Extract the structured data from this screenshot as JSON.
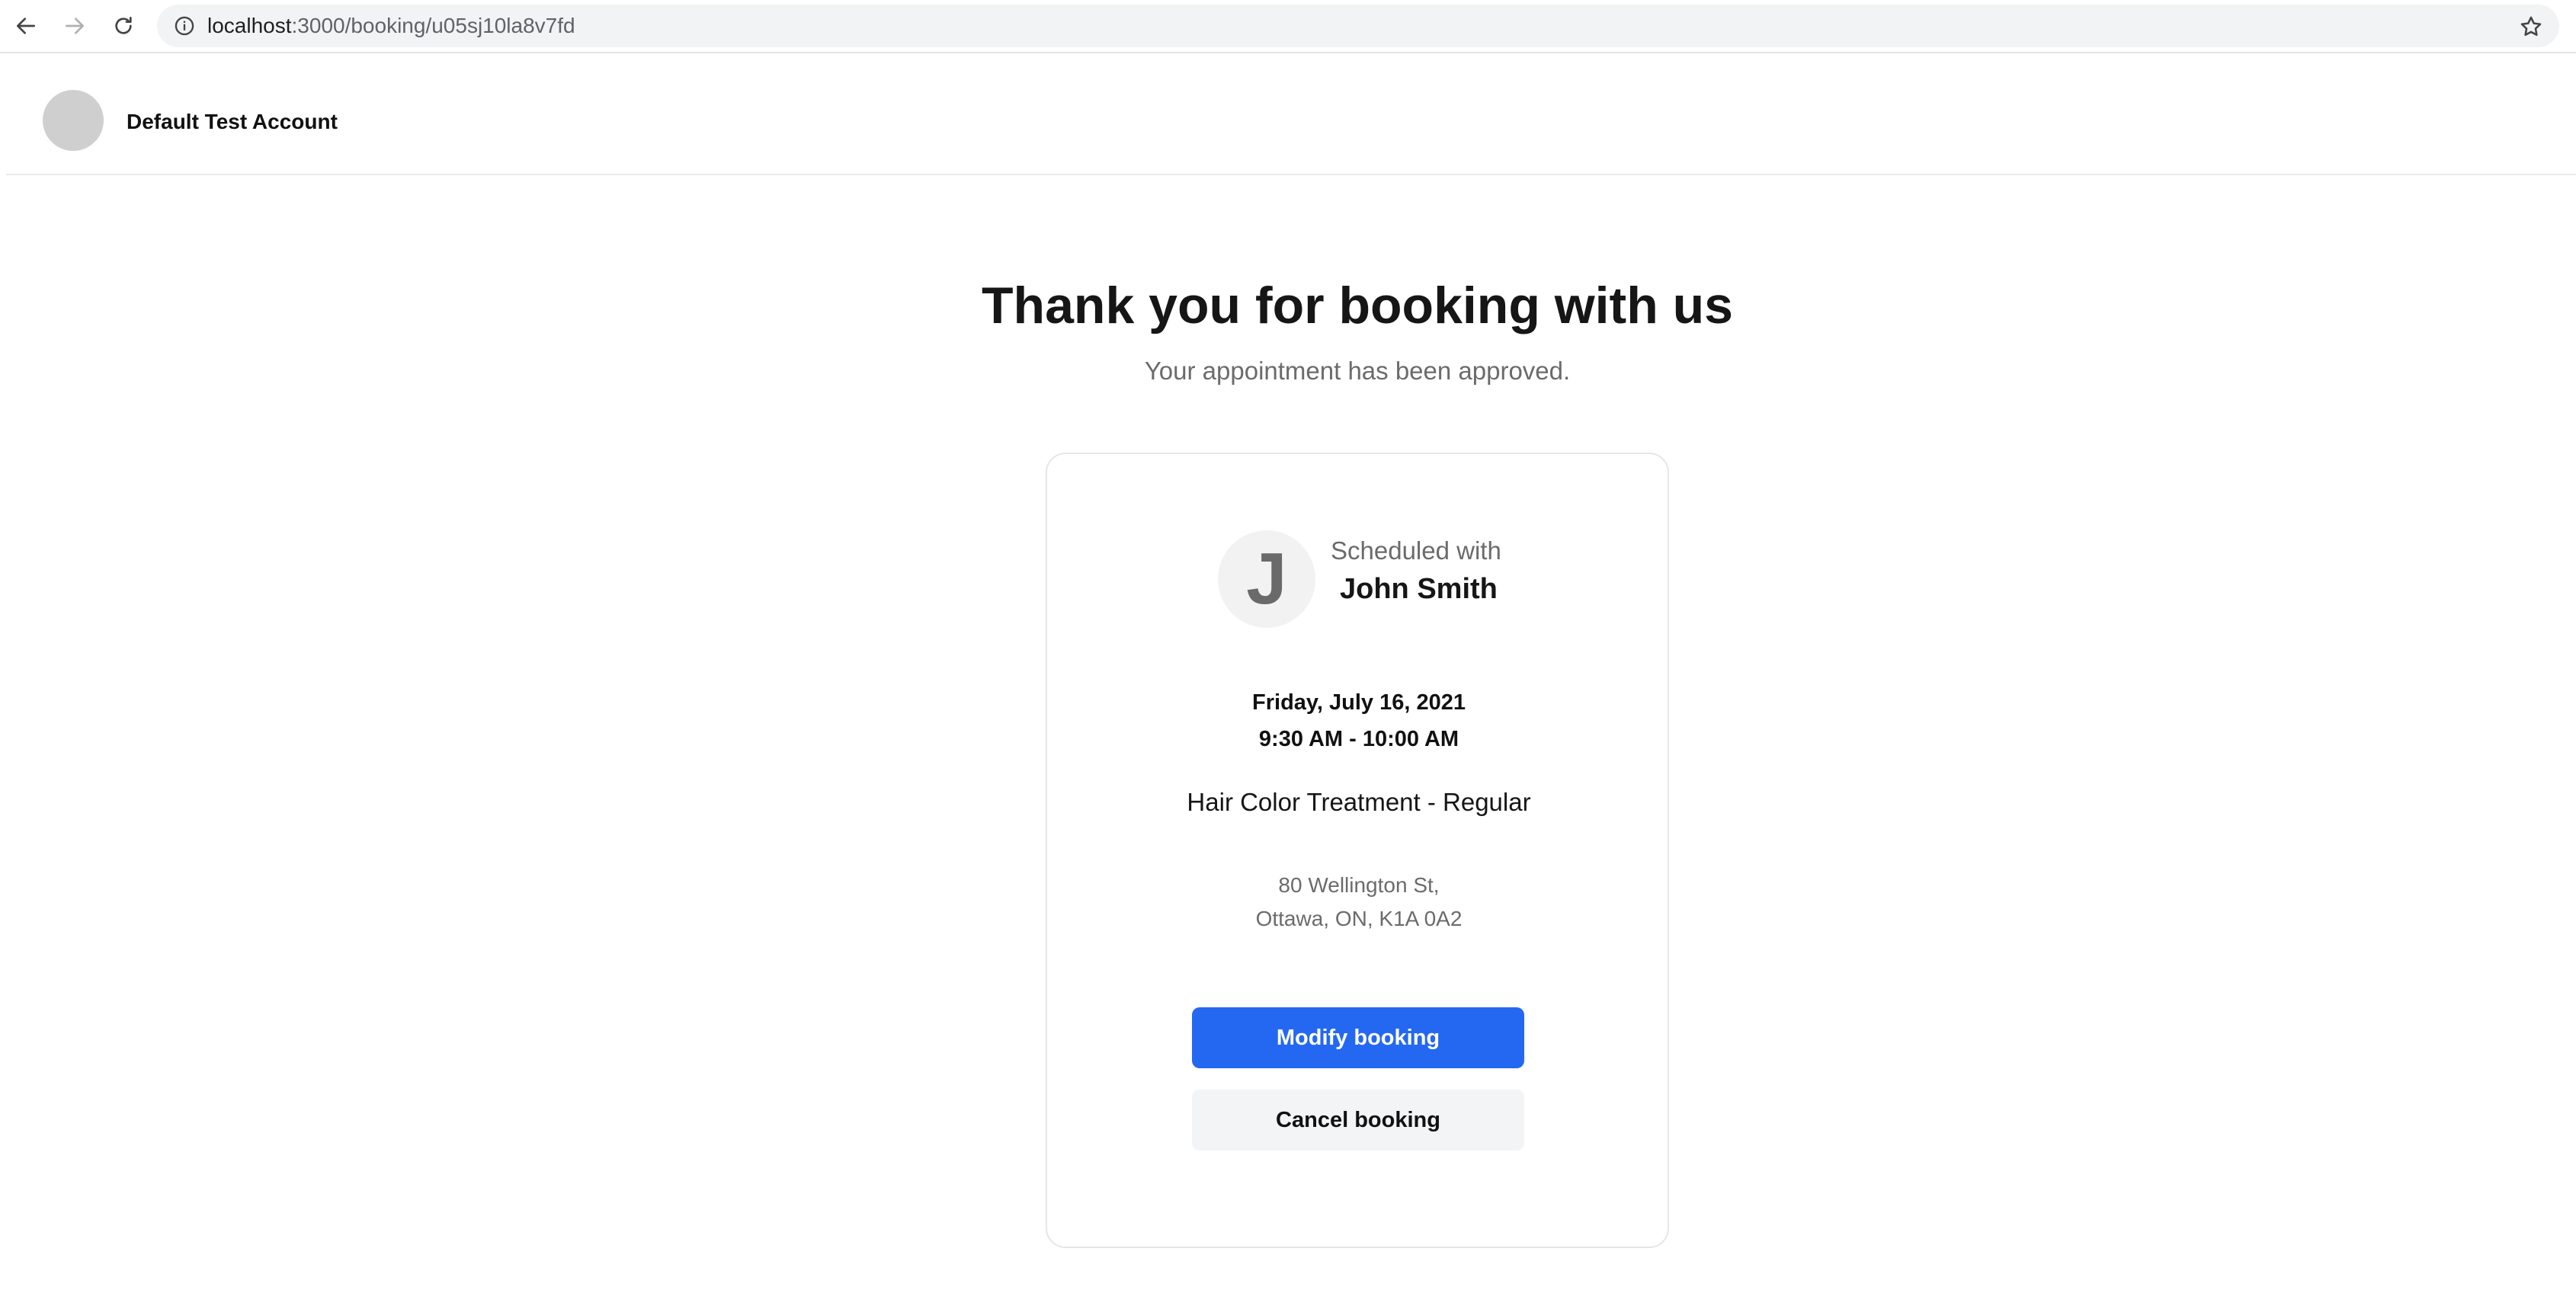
{
  "browser": {
    "url_host": "localhost",
    "url_path": ":3000/booking/u05sj10la8v7fd"
  },
  "header": {
    "account_name": "Default Test Account"
  },
  "main": {
    "title": "Thank you for booking with us",
    "subtitle": "Your appointment has been approved."
  },
  "card": {
    "host_initial": "J",
    "scheduled_with_label": "Scheduled with",
    "host_name": "John Smith",
    "date": "Friday, July 16, 2021",
    "time": "9:30 AM - 10:00 AM",
    "service": "Hair Color Treatment - Regular",
    "address_line1": "80 Wellington St,",
    "address_line2": "Ottawa, ON, K1A 0A2",
    "modify_label": "Modify booking",
    "cancel_label": "Cancel booking"
  },
  "colors": {
    "primary": "#2468f2",
    "secondary_button_bg": "#f3f4f6",
    "muted_text": "#6b6b6b"
  },
  "icons": {
    "back": "arrow-left-icon",
    "forward": "arrow-right-icon",
    "reload": "reload-icon",
    "site_info": "info-icon",
    "bookmark": "star-icon"
  }
}
